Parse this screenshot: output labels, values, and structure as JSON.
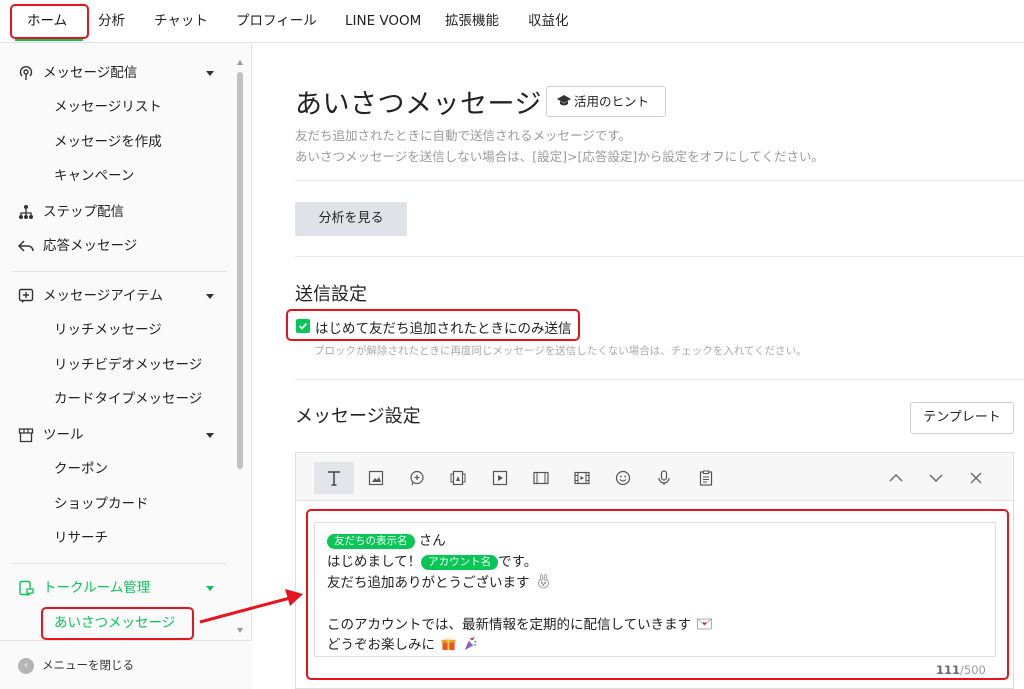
{
  "nav": {
    "tabs": [
      {
        "label": "ホーム"
      },
      {
        "label": "分析"
      },
      {
        "label": "チャット"
      },
      {
        "label": "プロフィール"
      },
      {
        "label": "LINE VOOM"
      },
      {
        "label": "拡張機能"
      },
      {
        "label": "収益化"
      }
    ],
    "active_color": "#06c755",
    "highlight_color": "#e8141d"
  },
  "sidebar": {
    "groups": [
      {
        "label": "メッセージ配信",
        "icon": "broadcast-icon",
        "items": [
          "メッセージリスト",
          "メッセージを作成",
          "キャンペーン"
        ]
      },
      {
        "label": "ステップ配信",
        "icon": "step-flow-icon"
      },
      {
        "label": "応答メッセージ",
        "icon": "reply-icon"
      },
      {
        "label": "メッセージアイテム",
        "icon": "message-item-icon",
        "items": [
          "リッチメッセージ",
          "リッチビデオメッセージ",
          "カードタイプメッセージ"
        ]
      },
      {
        "label": "ツール",
        "icon": "shop-icon",
        "items": [
          "クーポン",
          "ショップカード",
          "リサーチ"
        ]
      },
      {
        "label": "トークルーム管理",
        "icon": "talkroom-icon",
        "items": [
          "あいさつメッセージ"
        ]
      }
    ],
    "close_label": "メニューを閉じる"
  },
  "main": {
    "title": "あいさつメッセージ",
    "hint_button": "活用のヒント",
    "description": [
      "友だち追加されたときに自動で送信されるメッセージです。",
      "あいさつメッセージを送信しない場合は、[設定]>[応答設定]から設定をオフにしてください。"
    ],
    "analyze_button": "分析を見る",
    "send_settings": {
      "heading": "送信設定",
      "checkbox_label": "はじめて友だち追加されたときにのみ送信",
      "checked": true,
      "note": "ブロックが解除されたときに再度同じメッセージを送信したくない場合は、チェックを入れてください。"
    },
    "message_settings": {
      "heading": "メッセージ設定",
      "template_button": "テンプレート",
      "toolbar_icons": [
        "text-icon",
        "image-icon",
        "sticker-icon",
        "coupon-icon",
        "video-icon",
        "card-icon",
        "rich-video-icon",
        "emoji-icon",
        "microphone-icon",
        "survey-icon",
        "move-up-icon",
        "move-down-icon",
        "close-icon"
      ],
      "message": {
        "pill_friend_name": "友だちの表示名",
        "suffix_san": "さん",
        "line2_prefix": "はじめまして！",
        "pill_account_name": "アカウント名",
        "line2_suffix": "です。",
        "line3": "友だち追加ありがとうございます",
        "line5": "このアカウントでは、最新情報を定期的に配信していきます",
        "line6": "どうぞお楽しみに"
      },
      "count_current": "111",
      "count_max": "/500"
    }
  }
}
